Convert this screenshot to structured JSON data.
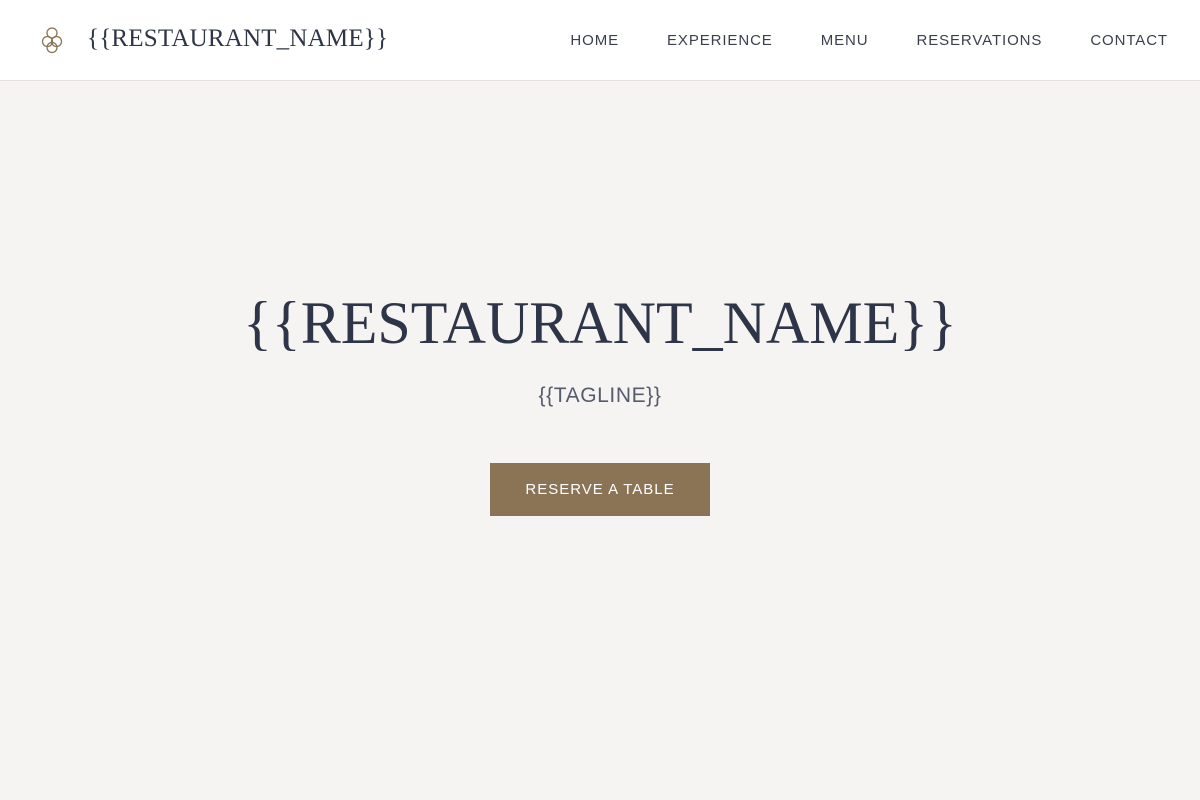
{
  "header": {
    "logo_icon": "flower-logo-icon",
    "brand_name": "{{RESTAURANT_NAME}}",
    "nav": [
      {
        "label": "HOME"
      },
      {
        "label": "EXPERIENCE"
      },
      {
        "label": "MENU"
      },
      {
        "label": "RESERVATIONS"
      },
      {
        "label": "CONTACT"
      }
    ]
  },
  "hero": {
    "title": "{{RESTAURANT_NAME}}",
    "tagline": "{{TAGLINE}}",
    "cta_label": "RESERVE A TABLE"
  },
  "colors": {
    "header_background": "#ffffff",
    "page_background": "#f6f4f2",
    "text_primary": "#2e3548",
    "text_muted": "#565c6c",
    "accent": "#8b7355"
  }
}
